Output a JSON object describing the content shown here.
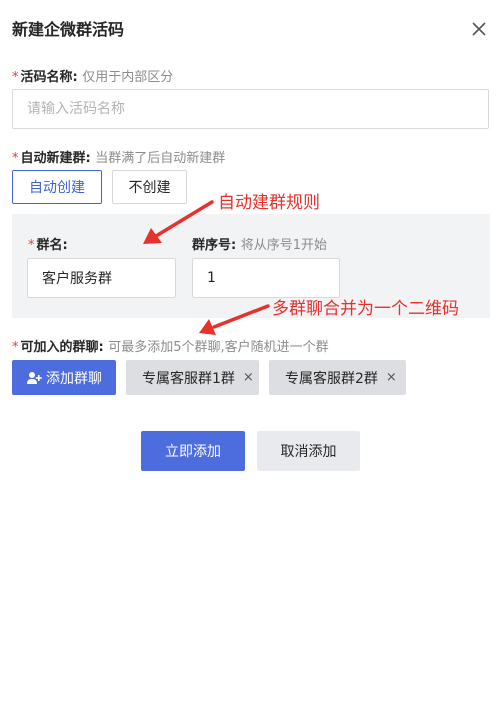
{
  "dialog": {
    "title": "新建企微群活码",
    "close_icon": "close-icon"
  },
  "name_field": {
    "required_mark": "*",
    "label": "活码名称:",
    "hint": "仅用于内部区分",
    "placeholder": "请输入活码名称"
  },
  "auto_group": {
    "required_mark": "*",
    "label": "自动新建群:",
    "hint": "当群满了后自动新建群",
    "options": [
      "自动创建",
      "不创建"
    ],
    "selected": "自动创建"
  },
  "group_settings": {
    "name_required_mark": "*",
    "name_label": "群名:",
    "name_value": "客户服务群",
    "seq_label": "群序号:",
    "seq_hint": "将从序号1开始",
    "seq_value": "1"
  },
  "joinable_groups": {
    "required_mark": "*",
    "label": "可加入的群聊:",
    "hint": "可最多添加5个群聊,客户随机进一个群",
    "add_button": "添加群聊",
    "add_icon": "add-user-icon",
    "tags": [
      "专属客服群1群",
      "专属客服群2群"
    ],
    "tag_close": "×"
  },
  "footer": {
    "confirm": "立即添加",
    "cancel": "取消添加"
  },
  "annotations": {
    "auto_rule": "自动建群规则",
    "merge_note": "多群聊合并为一个二维码",
    "color": "#e8302c"
  },
  "colors": {
    "primary": "#4d6cde",
    "active_border": "#4062d6",
    "required": "#e03c3c",
    "panel_bg": "#f2f3f5"
  }
}
